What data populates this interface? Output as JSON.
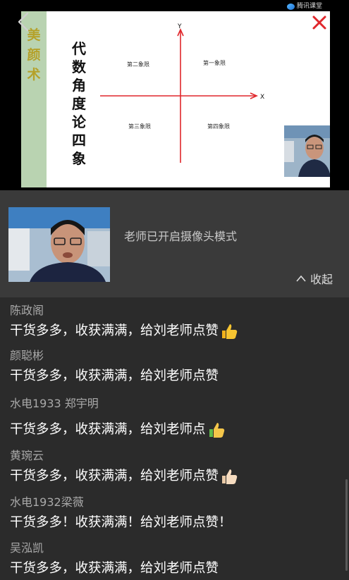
{
  "header": {
    "brand_label": "腾讯课堂",
    "back_icon": "chevron-left-icon",
    "close_icon": "close-icon",
    "accent_red": "#e0262b"
  },
  "slide": {
    "side_title": "美颜术",
    "main_title": "代数角度论四象",
    "axis_y_label": "Y",
    "axis_x_label": "X",
    "quadrant_2": "第二象限",
    "quadrant_1": "第一象限",
    "quadrant_3": "第三象限",
    "quadrant_4": "第四象限"
  },
  "camera": {
    "status_text": "老师已开启摄像头模式",
    "collapse_label": "收起",
    "collapse_icon": "chevron-up-icon"
  },
  "comments": [
    {
      "user": "陈政阁",
      "message": "干货多多，收获满满，给刘老师点赞",
      "emoji": "thumbs-up-yellow"
    },
    {
      "user": "颜聪彬",
      "message": "干货多多，收获满满，给刘老师点赞",
      "emoji": ""
    },
    {
      "user": "水电1933  郑宇明",
      "message": "干货多多，收获满满，给刘老师点",
      "emoji": "thumbs-up-green"
    },
    {
      "user": "黄琬云",
      "message": "干货多多，收获满满，给刘老师点赞",
      "emoji": "thumbs-up-light"
    },
    {
      "user": "水电1932梁薇",
      "message": "干货多多！收获满满！给刘老师点赞！",
      "emoji": ""
    },
    {
      "user": "吴泓凯",
      "message": "干货多多，收获满满，给刘老师点赞",
      "emoji": ""
    }
  ]
}
